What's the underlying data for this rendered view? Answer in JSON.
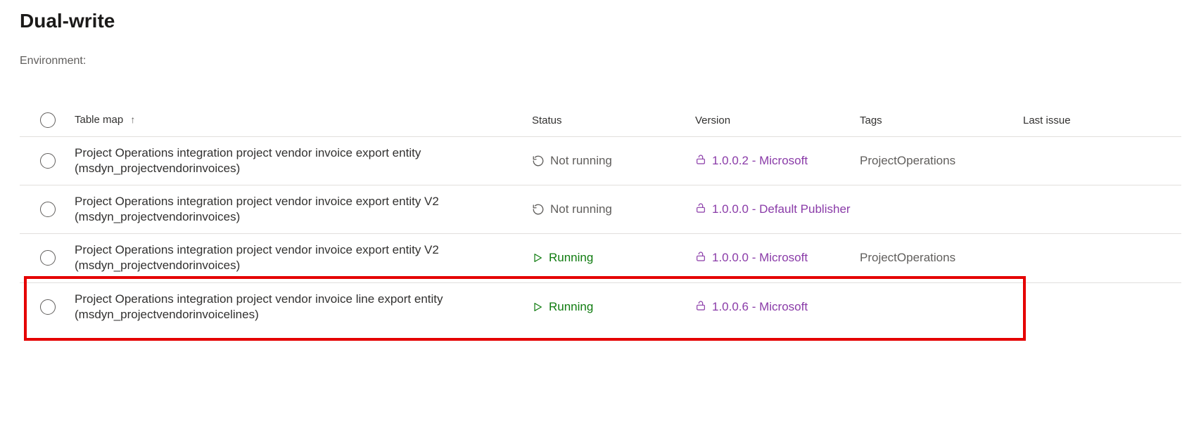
{
  "page": {
    "title": "Dual-write",
    "environment_label": "Environment:"
  },
  "columns": {
    "table_map": "Table map",
    "status": "Status",
    "version": "Version",
    "tags": "Tags",
    "last_issue": "Last issue"
  },
  "status_labels": {
    "not_running": "Not running",
    "running": "Running"
  },
  "rows": [
    {
      "name": "Project Operations integration project vendor invoice export entity (msdyn_projectvendorinvoices)",
      "status": "not_running",
      "version": "1.0.0.2 - Microsoft",
      "tags": "ProjectOperations",
      "highlighted": false
    },
    {
      "name": "Project Operations integration project vendor invoice export entity V2 (msdyn_projectvendorinvoices)",
      "status": "not_running",
      "version": "1.0.0.0 - Default Publisher",
      "tags": "",
      "highlighted": false
    },
    {
      "name": "Project Operations integration project vendor invoice export entity V2 (msdyn_projectvendorinvoices)",
      "status": "running",
      "version": "1.0.0.0 - Microsoft",
      "tags": "ProjectOperations",
      "highlighted": false
    },
    {
      "name": "Project Operations integration project vendor invoice line export entity (msdyn_projectvendorinvoicelines)",
      "status": "running",
      "version": "1.0.0.6 - Microsoft",
      "tags": "",
      "highlighted": true
    }
  ]
}
